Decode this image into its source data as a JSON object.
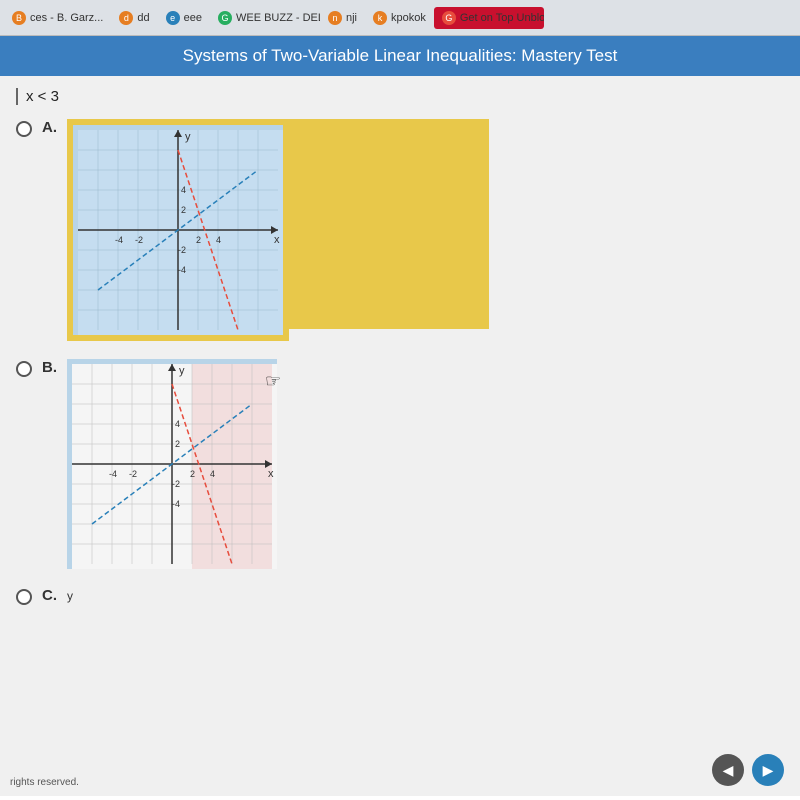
{
  "browser": {
    "tabs": [
      {
        "id": "tab1",
        "label": "ces - B. Garz...",
        "favicon_color": "orange",
        "favicon_text": "B"
      },
      {
        "id": "tab2",
        "label": "dd",
        "favicon_color": "orange",
        "favicon_text": "d"
      },
      {
        "id": "tab3",
        "label": "eee",
        "favicon_color": "blue",
        "favicon_text": "e"
      },
      {
        "id": "tab4",
        "label": "WEE BUZZ - DELICI...",
        "favicon_color": "green",
        "favicon_text": "G"
      },
      {
        "id": "tab5",
        "label": "nji",
        "favicon_color": "orange",
        "favicon_text": "n"
      },
      {
        "id": "tab6",
        "label": "kpokok",
        "favicon_color": "orange",
        "favicon_text": "k"
      },
      {
        "id": "tab7",
        "label": "Get on Top Unblock...",
        "favicon_color": "red",
        "favicon_text": "G",
        "highlight": true
      }
    ]
  },
  "page": {
    "title": "Systems of Two-Variable Linear Inequalities: Mastery Test",
    "inequality": "x < 3",
    "options": [
      {
        "id": "A",
        "label": "A."
      },
      {
        "id": "B",
        "label": "B."
      },
      {
        "id": "C",
        "label": "C."
      }
    ],
    "rights_text": "rights reserved.",
    "nav": {
      "back_label": "◀",
      "forward_label": "▶"
    }
  }
}
